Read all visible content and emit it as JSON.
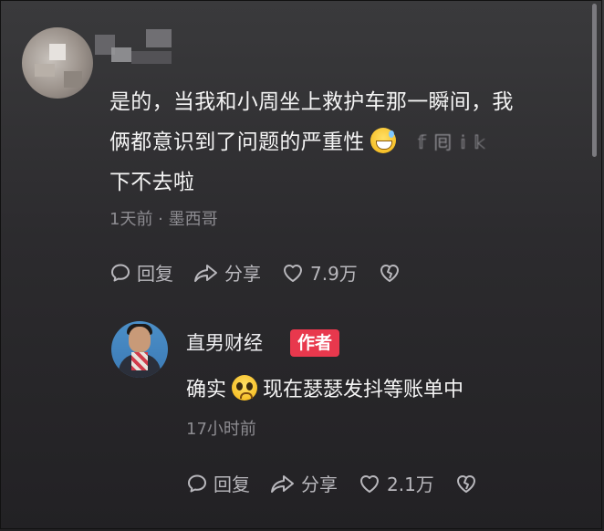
{
  "comment1": {
    "text_line1": "是的，当我和小周坐上救护车那一瞬间，我",
    "text_line2": "俩都意识到了问题的严重性",
    "text_faded": "𝕗 囘 𝕚 𝕜",
    "text_line3": "下不去啦",
    "emoji": "grinning-sweat-emoji",
    "meta": "1天前 · 墨西哥",
    "reply": "回复",
    "share": "分享",
    "likes": "7.9万"
  },
  "comment2": {
    "author": "直男财经",
    "badge": "作者",
    "text_before": "确实",
    "emoji": "pleading-face-emoji",
    "text_after": "现在瑟瑟发抖等账单中",
    "meta": "17小时前",
    "reply": "回复",
    "share": "分享",
    "likes": "2.1万"
  },
  "colors": {
    "background": "#2c2b2e",
    "badge": "#e8384d",
    "meta_text": "#8d8c91",
    "action_text": "#b9b8bd"
  }
}
